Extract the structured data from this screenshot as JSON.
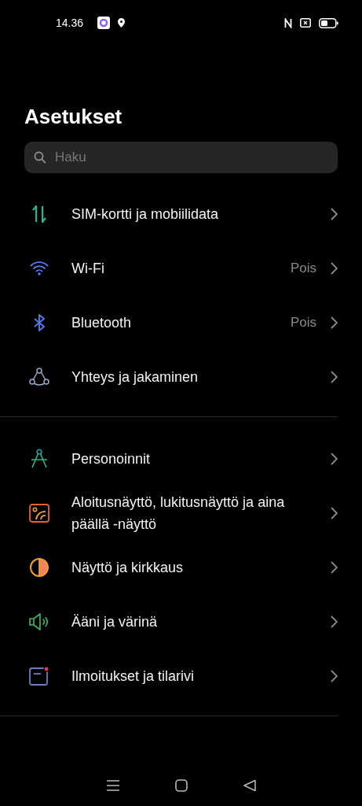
{
  "status_bar": {
    "time": "14.36"
  },
  "title": "Asetukset",
  "search": {
    "placeholder": "Haku"
  },
  "sections": [
    {
      "items": [
        {
          "label": "SIM-kortti ja mobiilidata"
        },
        {
          "label": "Wi-Fi",
          "value": "Pois"
        },
        {
          "label": "Bluetooth",
          "value": "Pois"
        },
        {
          "label": "Yhteys ja jakaminen"
        }
      ]
    },
    {
      "items": [
        {
          "label": "Personoinnit"
        },
        {
          "label": "Aloitusnäyttö, lukitusnäyttö ja aina päällä -näyttö"
        },
        {
          "label": "Näyttö ja kirkkaus"
        },
        {
          "label": "Ääni ja värinä"
        },
        {
          "label": "Ilmoitukset ja tilarivi"
        }
      ]
    }
  ]
}
